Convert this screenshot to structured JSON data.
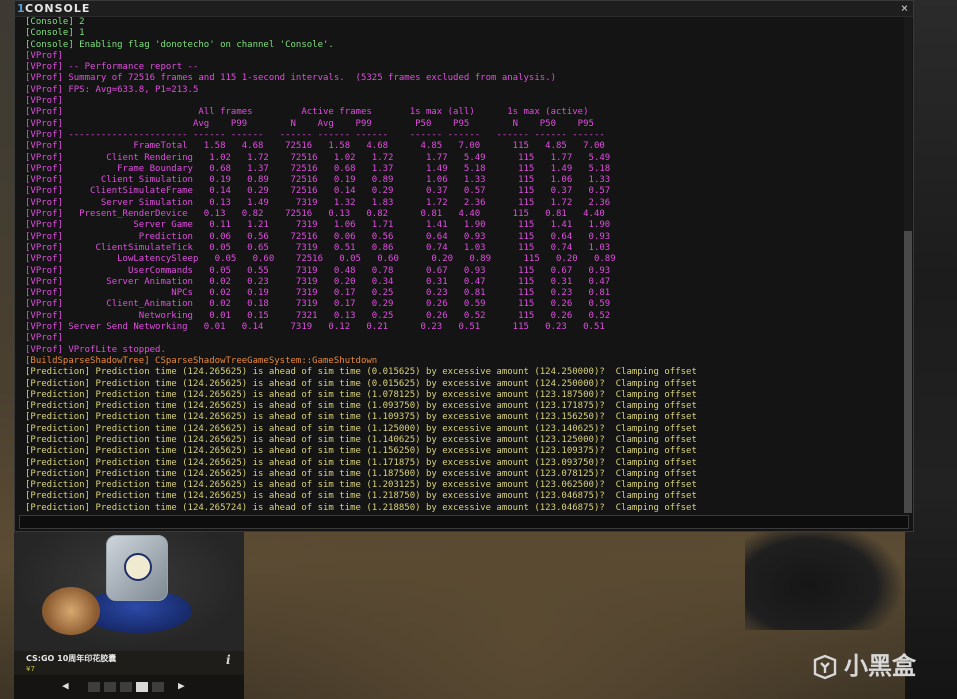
{
  "window": {
    "number": "1",
    "title": "CONSOLE",
    "close_symbol": "×"
  },
  "colors": {
    "green": "#7ee07e",
    "magenta": "#e04de0",
    "orange": "#e8883a",
    "yellow": "#d8d27a"
  },
  "log": [
    {
      "c": "green",
      "t": "[Console] 2"
    },
    {
      "c": "green",
      "t": "[Console] 1"
    },
    {
      "c": "green",
      "t": "[Console] Enabling flag 'donotecho' on channel 'Console'."
    },
    {
      "c": "mag",
      "t": "[VProf]"
    },
    {
      "c": "mag",
      "t": "[VProf] -- Performance report --"
    },
    {
      "c": "mag",
      "t": "[VProf] Summary of 72516 frames and 115 1-second intervals.  (5325 frames excluded from analysis.)"
    },
    {
      "c": "mag",
      "t": "[VProf] FPS: Avg=633.8, P1=213.5"
    },
    {
      "c": "mag",
      "t": "[VProf]"
    },
    {
      "c": "mag",
      "t": "[VProf]                         All frames         Active frames       1s max (all)      1s max (active)"
    },
    {
      "c": "mag",
      "t": "[VProf]                        Avg    P99        N    Avg    P99        P50    P95        N    P50    P95"
    },
    {
      "c": "mag",
      "t": "[VProf] ---------------------- ------ ------   ------ ------ ------    ------ ------   ------ ------ ------"
    },
    {
      "c": "mag",
      "t": "[VProf]             FrameTotal   1.58   4.68    72516   1.58   4.68      4.85   7.00      115   4.85   7.00"
    },
    {
      "c": "mag",
      "t": "[VProf]        Client Rendering   1.02   1.72    72516   1.02   1.72      1.77   5.49      115   1.77   5.49"
    },
    {
      "c": "mag",
      "t": "[VProf]          Frame Boundary   0.68   1.37    72516   0.68   1.37      1.49   5.18      115   1.49   5.18"
    },
    {
      "c": "mag",
      "t": "[VProf]       Client Simulation   0.19   0.89    72516   0.19   0.89      1.06   1.33      115   1.06   1.33"
    },
    {
      "c": "mag",
      "t": "[VProf]     ClientSimulateFrame   0.14   0.29    72516   0.14   0.29      0.37   0.57      115   0.37   0.57"
    },
    {
      "c": "mag",
      "t": "[VProf]       Server Simulation   0.13   1.49     7319   1.32   1.83      1.72   2.36      115   1.72   2.36"
    },
    {
      "c": "mag",
      "t": "[VProf]   Present_RenderDevice   0.13   0.82    72516   0.13   0.82      0.81   4.40      115   0.81   4.40"
    },
    {
      "c": "mag",
      "t": "[VProf]             Server Game   0.11   1.21     7319   1.06   1.71      1.41   1.90      115   1.41   1.90"
    },
    {
      "c": "mag",
      "t": "[VProf]              Prediction   0.06   0.56    72516   0.06   0.56      0.64   0.93      115   0.64   0.93"
    },
    {
      "c": "mag",
      "t": "[VProf]      ClientSimulateTick   0.05   0.65     7319   0.51   0.86      0.74   1.03      115   0.74   1.03"
    },
    {
      "c": "mag",
      "t": "[VProf]          LowLatencySleep   0.05   0.60    72516   0.05   0.60      0.20   0.89      115   0.20   0.89"
    },
    {
      "c": "mag",
      "t": "[VProf]            UserCommands   0.05   0.55     7319   0.48   0.78      0.67   0.93      115   0.67   0.93"
    },
    {
      "c": "mag",
      "t": "[VProf]        Server Animation   0.02   0.23     7319   0.20   0.34      0.31   0.47      115   0.31   0.47"
    },
    {
      "c": "mag",
      "t": "[VProf]                    NPCs   0.02   0.19     7319   0.17   0.25      0.23   0.81      115   0.23   0.81"
    },
    {
      "c": "mag",
      "t": "[VProf]        Client_Animation   0.02   0.18     7319   0.17   0.29      0.26   0.59      115   0.26   0.59"
    },
    {
      "c": "mag",
      "t": "[VProf]              Networking   0.01   0.15     7321   0.13   0.25      0.26   0.52      115   0.26   0.52"
    },
    {
      "c": "mag",
      "t": "[VProf] Server Send Networking   0.01   0.14     7319   0.12   0.21      0.23   0.51      115   0.23   0.51"
    },
    {
      "c": "mag",
      "t": "[VProf]"
    },
    {
      "c": "mag",
      "t": "[VProf] VProfLite stopped."
    },
    {
      "c": "orange",
      "t": "[BuildSparseShadowTree] CSparseShadowTreeGameSystem::GameShutdown"
    },
    {
      "c": "yellow",
      "t": "[Prediction] Prediction time (124.265625) is ahead of sim time (0.015625) by excessive amount (124.250000)?  Clamping offset"
    },
    {
      "c": "yellow",
      "t": "[Prediction] Prediction time (124.265625) is ahead of sim time (0.015625) by excessive amount (124.250000)?  Clamping offset"
    },
    {
      "c": "yellow",
      "t": "[Prediction] Prediction time (124.265625) is ahead of sim time (1.078125) by excessive amount (123.187500)?  Clamping offset"
    },
    {
      "c": "yellow",
      "t": "[Prediction] Prediction time (124.265625) is ahead of sim time (1.093750) by excessive amount (123.171875)?  Clamping offset"
    },
    {
      "c": "yellow",
      "t": "[Prediction] Prediction time (124.265625) is ahead of sim time (1.109375) by excessive amount (123.156250)?  Clamping offset"
    },
    {
      "c": "yellow",
      "t": "[Prediction] Prediction time (124.265625) is ahead of sim time (1.125000) by excessive amount (123.140625)?  Clamping offset"
    },
    {
      "c": "yellow",
      "t": "[Prediction] Prediction time (124.265625) is ahead of sim time (1.140625) by excessive amount (123.125000)?  Clamping offset"
    },
    {
      "c": "yellow",
      "t": "[Prediction] Prediction time (124.265625) is ahead of sim time (1.156250) by excessive amount (123.109375)?  Clamping offset"
    },
    {
      "c": "yellow",
      "t": "[Prediction] Prediction time (124.265625) is ahead of sim time (1.171875) by excessive amount (123.093750)?  Clamping offset"
    },
    {
      "c": "yellow",
      "t": "[Prediction] Prediction time (124.265625) is ahead of sim time (1.187500) by excessive amount (123.078125)?  Clamping offset"
    },
    {
      "c": "yellow",
      "t": "[Prediction] Prediction time (124.265625) is ahead of sim time (1.203125) by excessive amount (123.062500)?  Clamping offset"
    },
    {
      "c": "yellow",
      "t": "[Prediction] Prediction time (124.265625) is ahead of sim time (1.218750) by excessive amount (123.046875)?  Clamping offset"
    },
    {
      "c": "yellow",
      "t": "[Prediction] Prediction time (124.265724) is ahead of sim time (1.218850) by excessive amount (123.046875)?  Clamping offset"
    }
  ],
  "card": {
    "name": "CS:GO 10周年印花胶囊",
    "price": "¥7",
    "info_symbol": "i",
    "prev_symbol": "◀",
    "next_symbol": "▶",
    "page_count": 5,
    "active_page": 4
  },
  "background": {
    "logo_text": "小黑盒"
  }
}
